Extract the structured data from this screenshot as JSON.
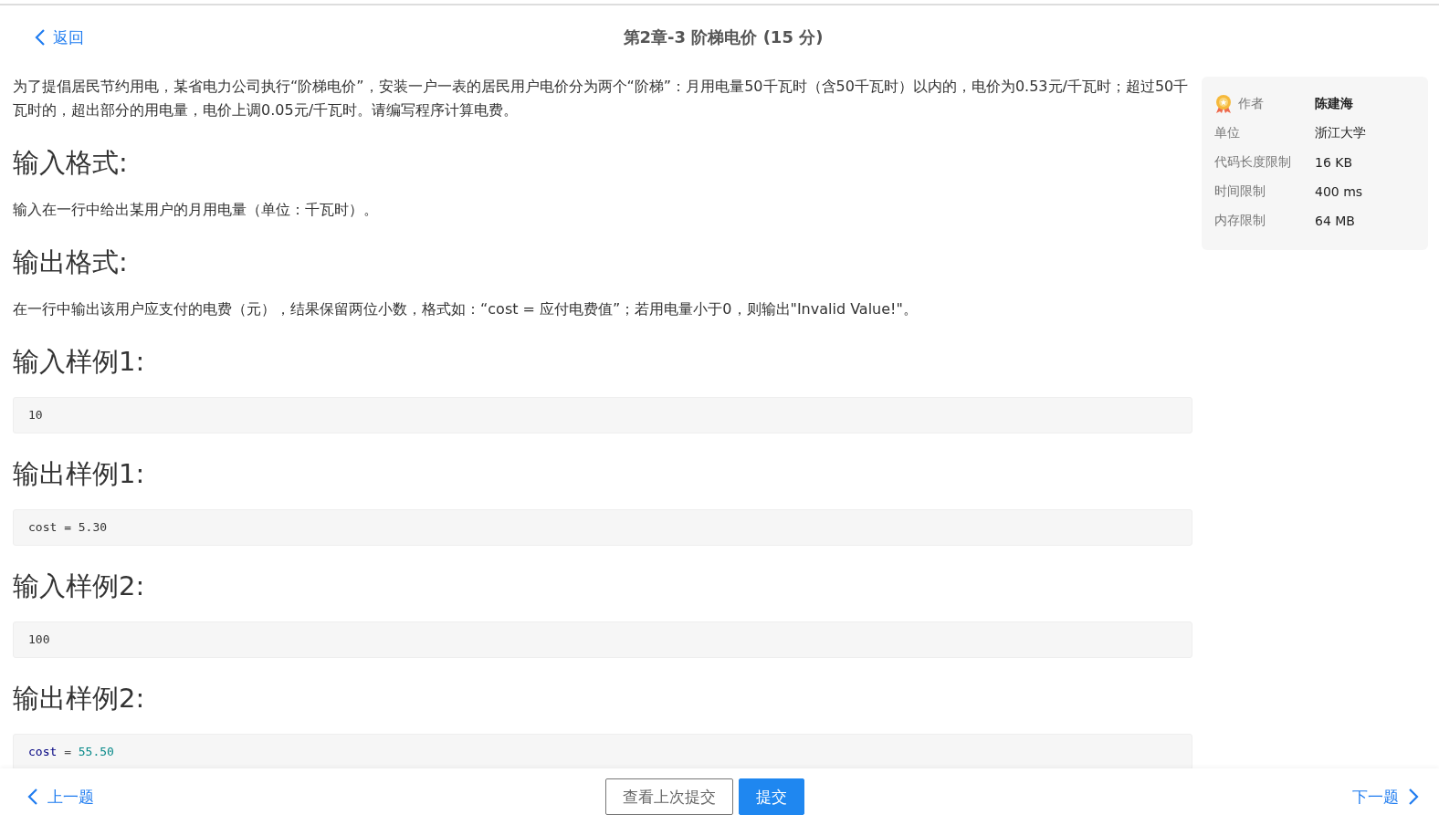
{
  "header": {
    "back": "返回",
    "title": "第2章-3 阶梯电价 (15 分)"
  },
  "description": "为了提倡居民节约用电，某省电力公司执行“阶梯电价”，安装一户一表的居民用户电价分为两个“阶梯”：月用电量50千瓦时（含50千瓦时）以内的，电价为0.53元/千瓦时；超过50千瓦时的，超出部分的用电量，电价上调0.05元/千瓦时。请编写程序计算电费。",
  "sections": [
    {
      "kind": "text",
      "heading": "输入格式:",
      "body": "输入在一行中给出某用户的月用电量（单位：千瓦时）。"
    },
    {
      "kind": "text",
      "heading": "输出格式:",
      "body": "在一行中输出该用户应支付的电费（元），结果保留两位小数，格式如：“cost = 应付电费值”；若用电量小于0，则输出\"Invalid Value!\"。"
    },
    {
      "kind": "code",
      "heading": "输入样例1:",
      "tokens": [
        {
          "kind": "plain",
          "text": "10"
        }
      ]
    },
    {
      "kind": "code",
      "heading": "输出样例1:",
      "tokens": [
        {
          "kind": "plain",
          "text": "cost = 5.30"
        }
      ]
    },
    {
      "kind": "code",
      "heading": "输入样例2:",
      "tokens": [
        {
          "kind": "plain",
          "text": "100"
        }
      ]
    },
    {
      "kind": "code",
      "heading": "输出样例2:",
      "tokens": [
        {
          "kind": "keyword",
          "text": "cost"
        },
        {
          "kind": "operator",
          "text": " = "
        },
        {
          "kind": "number",
          "text": "55.50"
        }
      ]
    }
  ],
  "info": [
    {
      "label": "作者",
      "value": "陈建海",
      "badge": true
    },
    {
      "label": "单位",
      "value": "浙江大学",
      "badge": false
    },
    {
      "label": "代码长度限制",
      "value": "16 KB",
      "badge": false
    },
    {
      "label": "时间限制",
      "value": "400 ms",
      "badge": false
    },
    {
      "label": "内存限制",
      "value": "64 MB",
      "badge": false
    }
  ],
  "footer": {
    "prev": "上一题",
    "buttons": [
      {
        "label": "查看上次提交",
        "kind": "secondary"
      },
      {
        "label": "提交",
        "kind": "primary"
      }
    ],
    "next": "下一题"
  }
}
